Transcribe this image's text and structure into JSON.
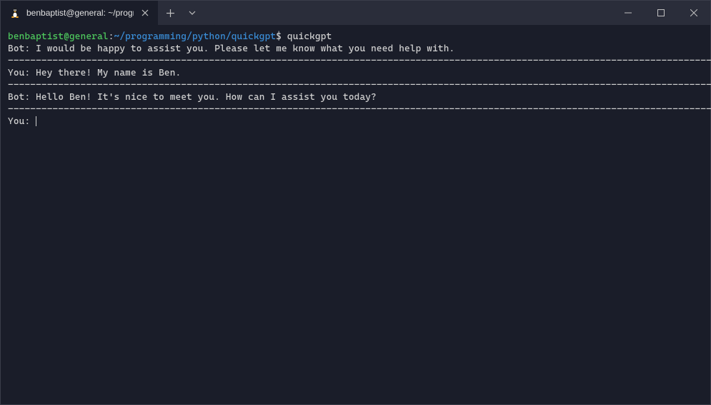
{
  "titlebar": {
    "tab_title": "benbaptist@general: ~/progra",
    "tab_icon_name": "tux-icon"
  },
  "terminal": {
    "prompt_user_host": "benbaptist@general",
    "prompt_colon": ":",
    "prompt_path": "~/programming/python/quickgpt",
    "prompt_symbol": "$",
    "command": "quickgpt",
    "lines": [
      "Bot: I would be happy to assist you. Please let me know what you need help with.",
      "You: Hey there! My name is Ben.",
      "Bot: Hello Ben! It's nice to meet you. How can I assist you today?"
    ],
    "divider": "----------------------------------------------------------------------------------------------------------------------------------------",
    "input_prompt": "You: "
  }
}
